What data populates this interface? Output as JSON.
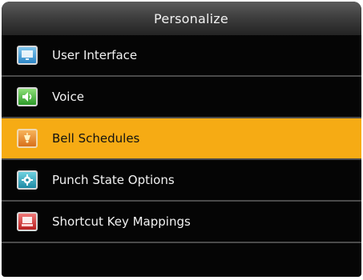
{
  "window": {
    "title": "Personalize"
  },
  "menu": {
    "items": [
      {
        "label": "User Interface",
        "icon": "monitor-icon",
        "selected": false
      },
      {
        "label": "Voice",
        "icon": "speaker-icon",
        "selected": false
      },
      {
        "label": "Bell Schedules",
        "icon": "bell-icon",
        "selected": true
      },
      {
        "label": "Punch State Options",
        "icon": "gear-icon",
        "selected": false
      },
      {
        "label": "Shortcut Key Mappings",
        "icon": "keyboard-icon",
        "selected": false
      }
    ]
  },
  "colors": {
    "background": "#050505",
    "selection": "#f6ab14",
    "text": "#f2f2f2",
    "selected_text": "#111111"
  }
}
